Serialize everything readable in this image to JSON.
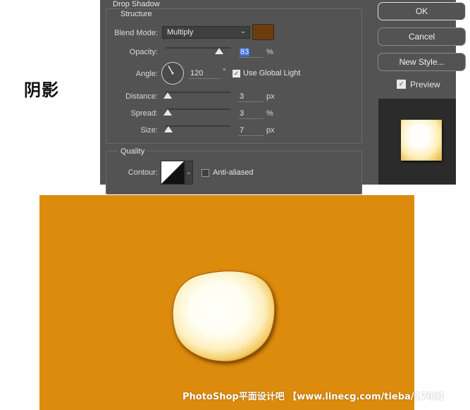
{
  "side_label": "阴影",
  "dialog": {
    "section_title": "Drop Shadow",
    "structure_title": "Structure",
    "blend_mode": {
      "label": "Blend Mode:",
      "value": "Multiply",
      "swatch_color": "#6b3c0c"
    },
    "opacity": {
      "label": "Opacity:",
      "value": "83",
      "unit": "%",
      "fraction": 0.83
    },
    "angle": {
      "label": "Angle:",
      "value": "120",
      "unit": "°",
      "degrees": 120
    },
    "use_global_light": {
      "label": "Use Global Light",
      "checked": true
    },
    "distance": {
      "label": "Distance:",
      "value": "3",
      "unit": "px",
      "fraction": 0.03
    },
    "spread": {
      "label": "Spread:",
      "value": "3",
      "unit": "%",
      "fraction": 0.03
    },
    "size": {
      "label": "Size:",
      "value": "7",
      "unit": "px",
      "fraction": 0.04
    },
    "quality_title": "Quality",
    "contour": {
      "label": "Contour:"
    },
    "anti_aliased": {
      "label": "Anti-aliased",
      "checked": false
    }
  },
  "buttons": {
    "ok": "OK",
    "cancel": "Cancel",
    "new_style": "New Style...",
    "preview": {
      "label": "Preview",
      "checked": true
    }
  },
  "canvas": {
    "background_color": "#dd8b0c",
    "watermark": "PhotoShop平面设计吧 【www.linecg.com/tieba/1783】"
  }
}
